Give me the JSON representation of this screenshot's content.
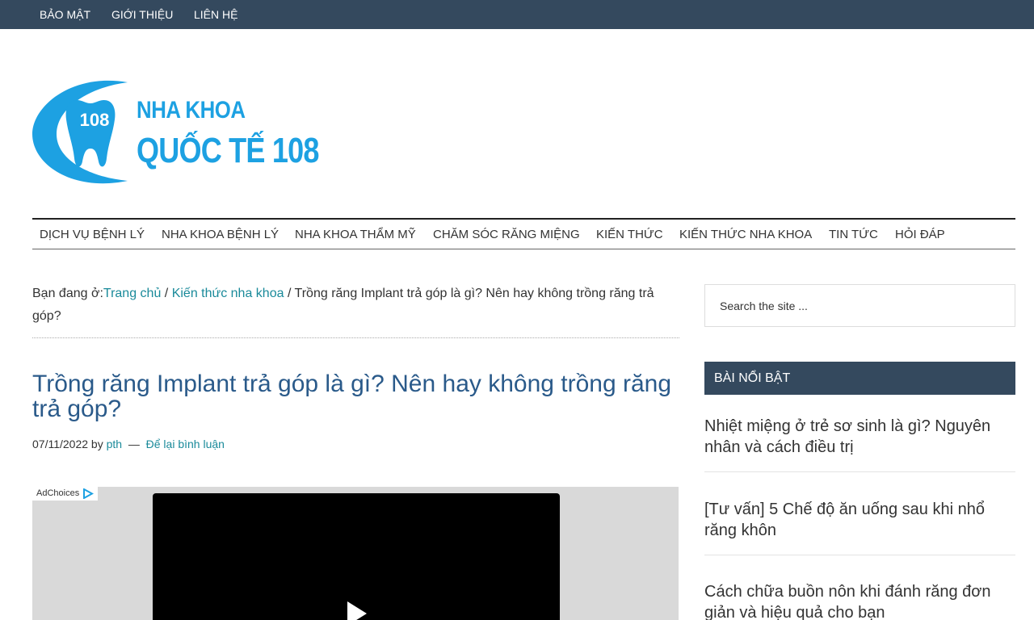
{
  "topbar": {
    "items": [
      {
        "label": "BẢO MẬT"
      },
      {
        "label": "GIỚI THIỆU"
      },
      {
        "label": "LIÊN HỆ"
      }
    ]
  },
  "logo": {
    "badge": "108",
    "line1": "NHA KHOA",
    "line2": "QUỐC TẾ 108",
    "color": "#1da1e2"
  },
  "nav": {
    "items": [
      {
        "label": "DỊCH VỤ BỆNH LÝ"
      },
      {
        "label": "NHA KHOA BỆNH LÝ"
      },
      {
        "label": "NHA KHOA THẨM MỸ"
      },
      {
        "label": "CHĂM SÓC RĂNG MIỆNG"
      },
      {
        "label": "KIẾN THỨC"
      },
      {
        "label": "KIẾN THỨC NHA KHOA"
      },
      {
        "label": "TIN TỨC"
      },
      {
        "label": "HỎI ĐÁP"
      }
    ]
  },
  "breadcrumb": {
    "prefix": "Bạn đang ở:",
    "home": "Trang chủ",
    "sep1": " / ",
    "category": "Kiến thức nha khoa",
    "sep2": " / ",
    "current": "Trồng răng Implant trả góp là gì? Nên hay không trồng răng trả góp?"
  },
  "post": {
    "title": "Trồng răng Implant trả góp là gì? Nên hay không trồng răng trả góp?",
    "date": "07/11/2022",
    "by": "by",
    "author": "pth",
    "dash": "—",
    "comment_link": "Để lại bình luận"
  },
  "ad": {
    "adchoices": "AdChoices"
  },
  "sidebar": {
    "search_placeholder": "Search the site ...",
    "widget_title": "BÀI NỔI BẬT",
    "featured": [
      {
        "title": "Nhiệt miệng ở trẻ sơ sinh là gì? Nguyên nhân và cách điều trị"
      },
      {
        "title": "[Tư vấn] 5 Chế độ ăn uống sau khi nhổ răng khôn"
      },
      {
        "title": "Cách chữa buồn nôn khi đánh răng đơn giản và hiệu quả cho bạn"
      }
    ]
  },
  "colors": {
    "topbar_bg": "#34495e",
    "link": "#1a8a9a",
    "title": "#2a5a8a"
  }
}
